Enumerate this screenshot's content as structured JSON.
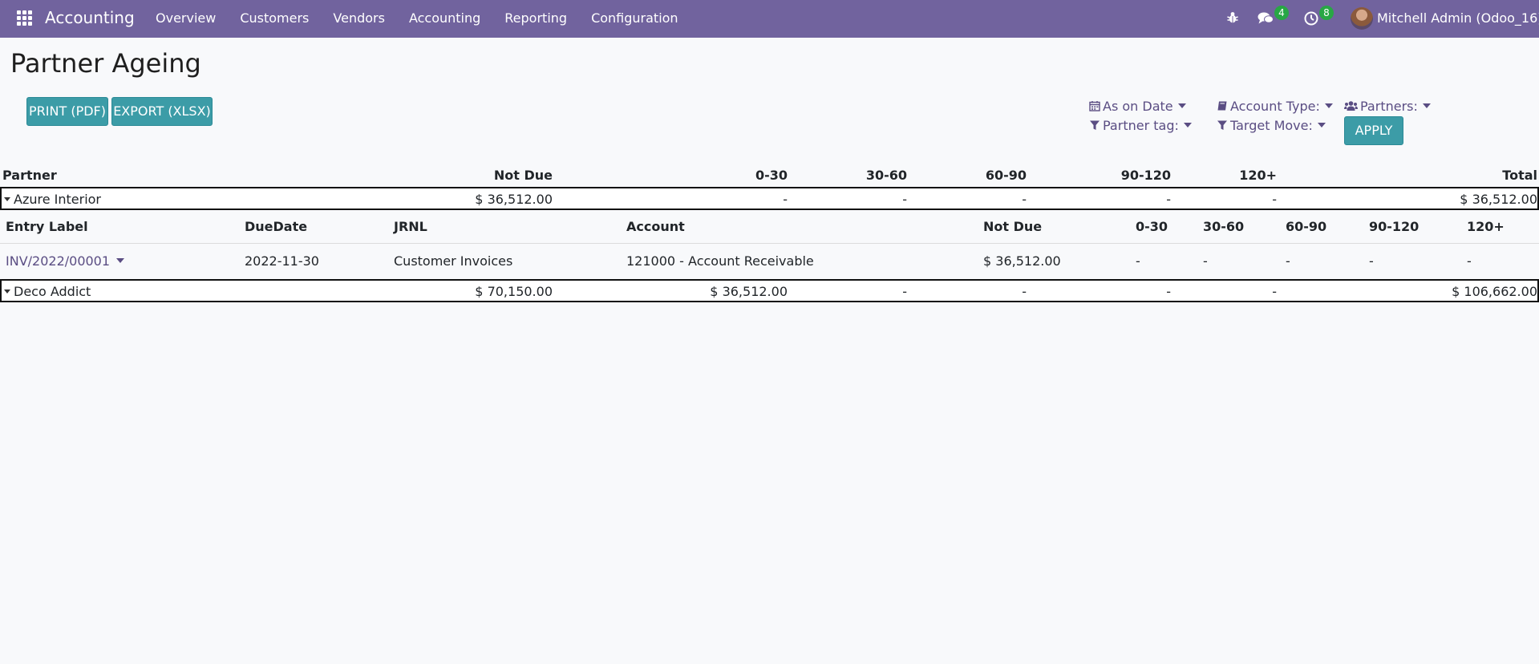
{
  "navbar": {
    "app_name": "Accounting",
    "menu": [
      "Overview",
      "Customers",
      "Vendors",
      "Accounting",
      "Reporting",
      "Configuration"
    ],
    "messages_count": "4",
    "activities_count": "8",
    "user_name": "Mitchell Admin (Odoo_16)",
    "color": "#71639e"
  },
  "page": {
    "title": "Partner Ageing",
    "print_label": "PRINT (PDF)",
    "export_label": "EXPORT (XLSX)",
    "apply_label": "APPLY"
  },
  "filters": {
    "as_on_date": "As on Date",
    "account_type": "Account Type:",
    "partners": "Partners:",
    "partner_tag": "Partner tag:",
    "target_move": "Target Move:"
  },
  "table": {
    "headers": [
      "Partner",
      "Not Due",
      "0-30",
      "30-60",
      "60-90",
      "90-120",
      "120+",
      "Total"
    ],
    "rows": [
      {
        "partner": "Azure Interior",
        "not_due": "$ 36,512.00",
        "d0_30": "-",
        "d30_60": "-",
        "d60_90": "-",
        "d90_120": "-",
        "d120": "-",
        "total": "$ 36,512.00"
      },
      {
        "partner": "Deco Addict",
        "not_due": "$ 70,150.00",
        "d0_30": "$ 36,512.00",
        "d30_60": "-",
        "d60_90": "-",
        "d90_120": "-",
        "d120": "-",
        "total": "$ 106,662.00"
      }
    ],
    "sub_headers": [
      "Entry Label",
      "DueDate",
      "JRNL",
      "Account",
      "Not Due",
      "0-30",
      "30-60",
      "60-90",
      "90-120",
      "120+"
    ],
    "sub_rows": [
      {
        "entry_label": "INV/2022/00001",
        "due_date": "2022-11-30",
        "jrnl": "Customer Invoices",
        "account": "121000 - Account Receivable",
        "not_due": "$ 36,512.00",
        "d0_30": "-",
        "d30_60": "-",
        "d60_90": "-",
        "d90_120": "-",
        "d120": "-"
      }
    ]
  }
}
